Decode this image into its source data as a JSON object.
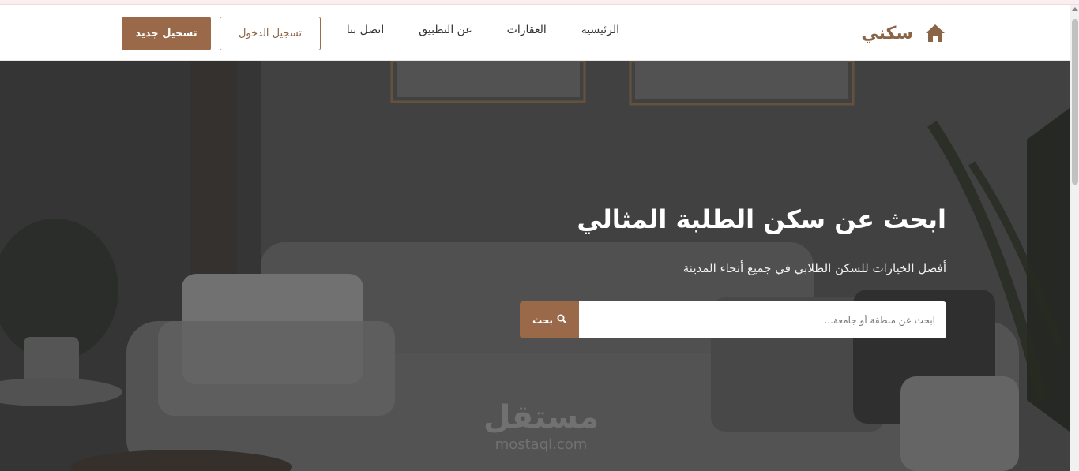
{
  "navbar": {
    "brand_name": "سكني",
    "brand_icon": "home-icon",
    "links": [
      "الرئيسية",
      "العقارات",
      "عن التطبيق",
      "اتصل بنا"
    ],
    "login_label": "تسجيل الدخول",
    "register_label": "تسجيل جديد"
  },
  "hero": {
    "title": "ابحث عن سكن الطلبة المثالي",
    "subtitle": "أفضل الخيارات للسكن الطلابي في جميع أنحاء المدينة",
    "search_placeholder": "ابحث عن منطقة أو جامعة...",
    "search_button_label": "بحث",
    "search_icon": "search-icon"
  },
  "watermark": {
    "arabic": "مستقل",
    "latin": "mostaql.com"
  },
  "colors": {
    "accent": "#99694a",
    "brand": "#8b6446",
    "nav_bg": "#ffffff",
    "hero_text": "#ffffff"
  }
}
